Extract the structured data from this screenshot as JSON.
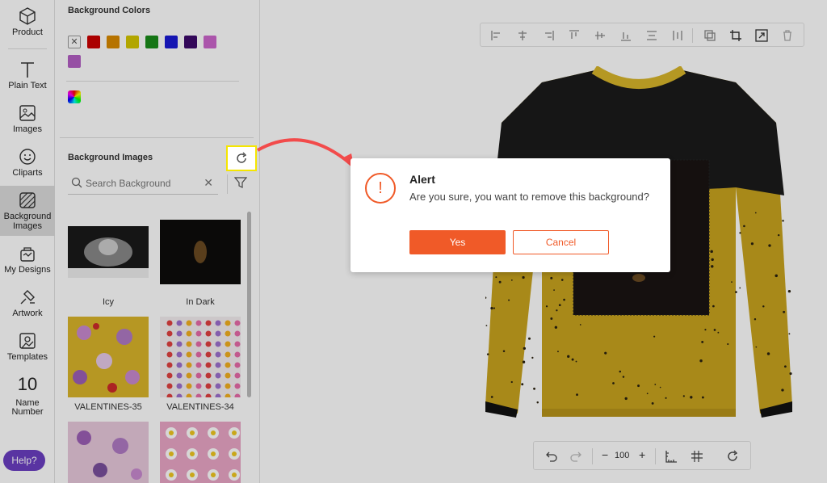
{
  "nav": {
    "items": [
      {
        "label": "Product",
        "icon": "cube-icon"
      },
      {
        "label": "Plain Text",
        "icon": "text-icon"
      },
      {
        "label": "Images",
        "icon": "image-icon"
      },
      {
        "label": "Cliparts",
        "icon": "smiley-icon"
      },
      {
        "label": "Background Images",
        "icon": "background-images-icon"
      },
      {
        "label": "My Designs",
        "icon": "designs-icon"
      },
      {
        "label": "Artwork",
        "icon": "artwork-icon"
      },
      {
        "label": "Templates",
        "icon": "templates-icon"
      },
      {
        "number": "10",
        "label": "Name Number"
      }
    ],
    "help_label": "Help?"
  },
  "panel": {
    "bg_colors_title": "Background Colors",
    "none_glyph": "✕",
    "colors": [
      "#cc0000",
      "#d98a00",
      "#d4c600",
      "#1a8c1a",
      "#1a1ad4",
      "#3d0a6b",
      "#cc66cc",
      "#b35fc4"
    ],
    "bg_images_title": "Background Images",
    "search_placeholder": "Search Background",
    "images": [
      {
        "label": "Icy"
      },
      {
        "label": "In Dark"
      },
      {
        "label": "VALENTINES-35"
      },
      {
        "label": "VALENTINES-34"
      },
      {
        "label": ""
      },
      {
        "label": ""
      }
    ]
  },
  "canvas": {
    "zoom": "100"
  },
  "dialog": {
    "title": "Alert",
    "message": "Are you sure, you want to remove this background?",
    "yes_label": "Yes",
    "cancel_label": "Cancel",
    "icon_glyph": "!"
  },
  "colors": {
    "accent": "#f05a28",
    "help": "#6b3fc2",
    "highlight": "#f5e600",
    "shirt_yellow": "#c9a41e",
    "shirt_black": "#1b1b1b"
  }
}
